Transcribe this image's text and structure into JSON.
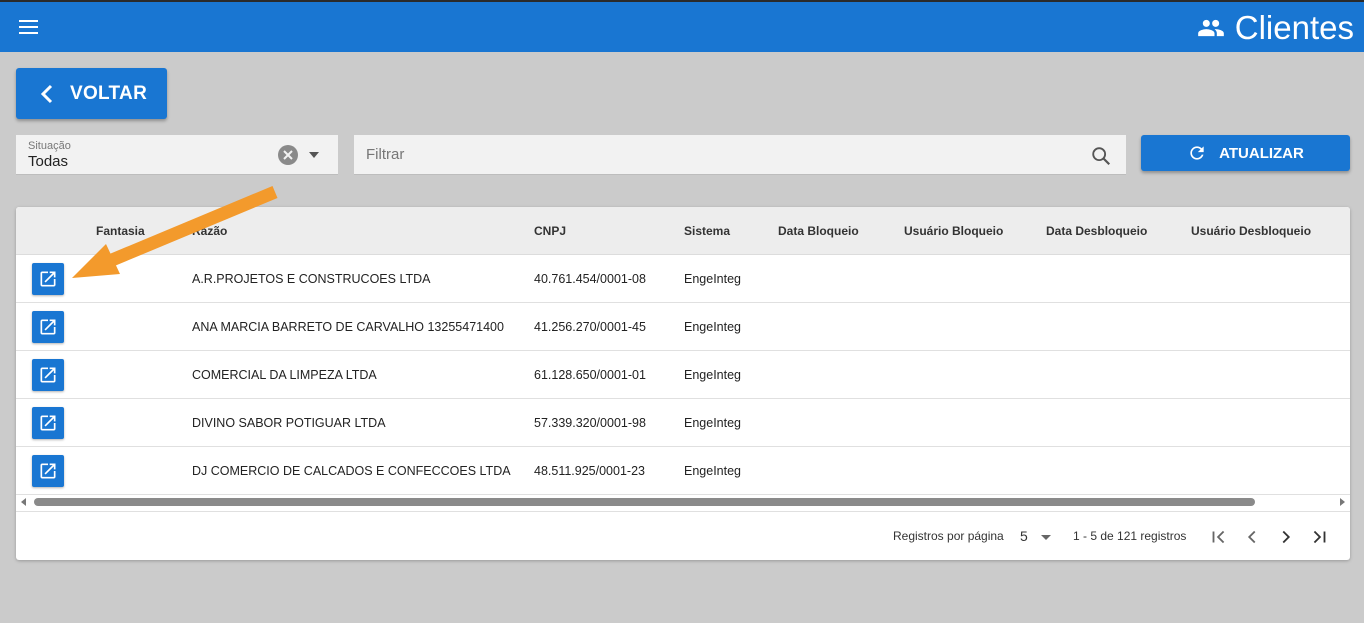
{
  "appbar": {
    "title": "Clientes",
    "title_icon": "people-icon",
    "menu_icon": "hamburger-menu-icon"
  },
  "toolbar": {
    "back_label": "VOLTAR",
    "refresh_label": "ATUALIZAR"
  },
  "situacao": {
    "label": "Situação",
    "value": "Todas"
  },
  "filter": {
    "placeholder": "Filtrar"
  },
  "table": {
    "columns": [
      "Fantasia",
      "Razão",
      "CNPJ",
      "Sistema",
      "Data Bloqueio",
      "Usuário Bloqueio",
      "Data Desbloqueio",
      "Usuário Desbloqueio"
    ],
    "rows": [
      {
        "fantasia": "",
        "razao": "A.R.PROJETOS E CONSTRUCOES LTDA",
        "cnpj": "40.761.454/0001-08",
        "sistema": "EngeInteg"
      },
      {
        "fantasia": "",
        "razao": "ANA MARCIA BARRETO DE CARVALHO 13255471400",
        "cnpj": "41.256.270/0001-45",
        "sistema": "EngeInteg"
      },
      {
        "fantasia": "",
        "razao": "COMERCIAL DA LIMPEZA LTDA",
        "cnpj": "61.128.650/0001-01",
        "sistema": "EngeInteg"
      },
      {
        "fantasia": "",
        "razao": "DIVINO SABOR POTIGUAR LTDA",
        "cnpj": "57.339.320/0001-98",
        "sistema": "EngeInteg"
      },
      {
        "fantasia": "",
        "razao": "DJ COMERCIO DE CALCADOS E CONFECCOES LTDA",
        "cnpj": "48.511.925/0001-23",
        "sistema": "EngeInteg"
      }
    ]
  },
  "pagination": {
    "rows_per_page_label": "Registros por página",
    "rows_per_page": "5",
    "range": "1 - 5 de 121 registros"
  },
  "colors": {
    "primary": "#1976d2",
    "annotation_arrow": "#f39a2c",
    "background": "#cbcbcb"
  }
}
